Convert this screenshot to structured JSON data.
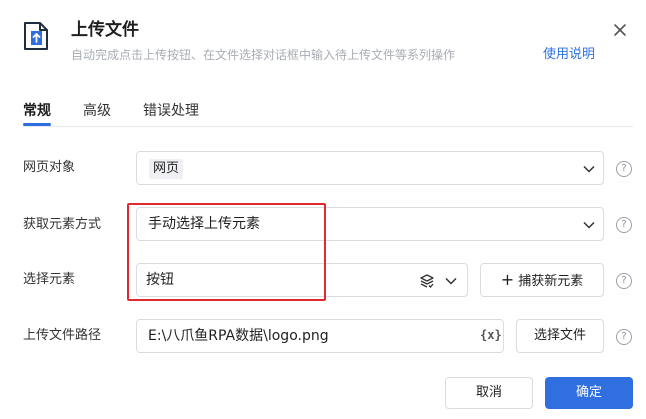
{
  "header": {
    "title": "上传文件",
    "subtitle": "自动完成点击上传按钮、在文件选择对话框中输入待上传文件等系列操作",
    "help_link": "使用说明",
    "icon": "file-upload-icon"
  },
  "tabs": [
    {
      "label": "常规",
      "active": true
    },
    {
      "label": "高级",
      "active": false
    },
    {
      "label": "错误处理",
      "active": false
    }
  ],
  "form": {
    "web_object": {
      "label": "网页对象",
      "value": "网页"
    },
    "get_method": {
      "label": "获取元素方式",
      "value": "手动选择上传元素"
    },
    "select_element": {
      "label": "选择元素",
      "value": "按钮",
      "capture_button": "捕获新元素"
    },
    "file_path": {
      "label": "上传文件路径",
      "value": "E:\\八爪鱼RPA数据\\logo.png",
      "var_symbol": "{x}",
      "choose_button": "选择文件"
    }
  },
  "footer": {
    "cancel": "取消",
    "confirm": "确定"
  },
  "colors": {
    "accent": "#2f6fe0",
    "highlight": "#e0282e"
  }
}
